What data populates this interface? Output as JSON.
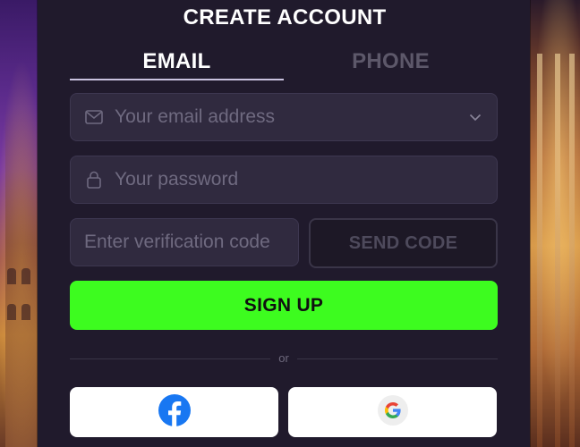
{
  "modal": {
    "title": "CREATE ACCOUNT"
  },
  "tabs": [
    {
      "label": "EMAIL",
      "active": true
    },
    {
      "label": "PHONE",
      "active": false
    }
  ],
  "form": {
    "email": {
      "placeholder": "Your email address",
      "icon": "mail-icon"
    },
    "password": {
      "placeholder": "Your password",
      "icon": "lock-icon"
    },
    "verification": {
      "placeholder": "Enter verification code"
    },
    "send_code_label": "SEND CODE",
    "signup_label": "SIGN UP"
  },
  "divider": {
    "text": "or"
  },
  "social": {
    "facebook_icon": "facebook-icon",
    "google_icon": "google-icon"
  },
  "colors": {
    "accent_green": "#3dfc1f",
    "modal_bg": "#201a2c",
    "field_bg": "#302a3f",
    "facebook_blue": "#1877f2"
  }
}
